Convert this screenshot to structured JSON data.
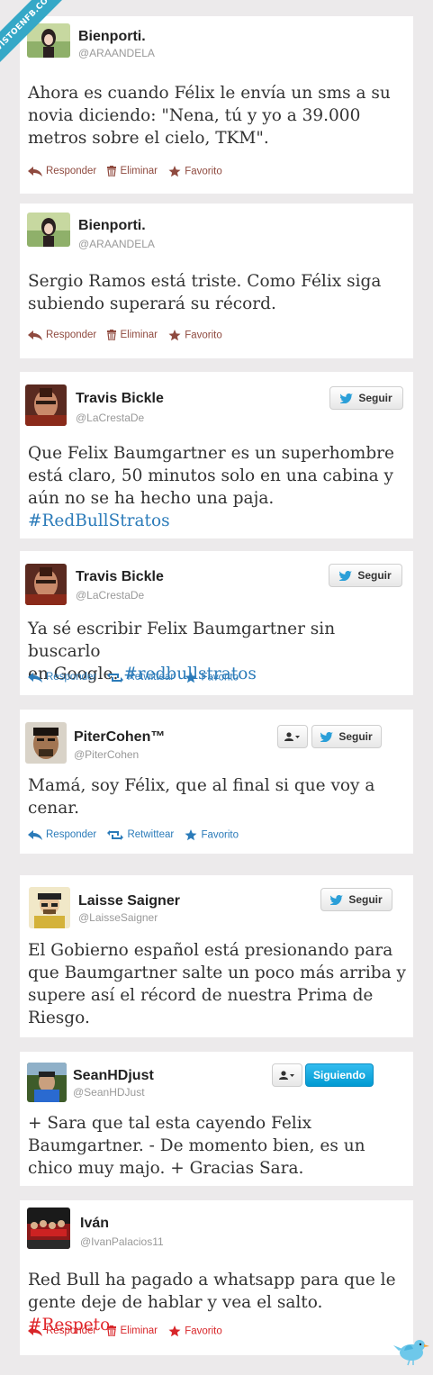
{
  "watermark": "VISTOENFB.COM",
  "tweets": [
    {
      "name": "Bienporti.",
      "handle": "@ARAANDELA",
      "text_lines": [
        "Ahora es cuando Félix le envía un sms a su",
        "novia diciendo: \"Nena, tú y yo a 39.000",
        "metros sobre el cielo, TKM\"."
      ],
      "actions": [
        "Responder",
        "Eliminar",
        "Favorito"
      ]
    },
    {
      "name": "Bienporti.",
      "handle": "@ARAANDELA",
      "text_lines": [
        "Sergio Ramos está triste. Como Félix siga",
        "subiendo superará su récord."
      ],
      "actions": [
        "Responder",
        "Eliminar",
        "Favorito"
      ]
    },
    {
      "name": "Travis Bickle",
      "handle": "@LaCrestaDe",
      "follow_label": "Seguir",
      "text_lines": [
        "Que Felix Baumgartner es un superhombre",
        "está claro, 50 minutos solo en una cabina y",
        "aún no se ha hecho una paja."
      ],
      "hashtag": "#RedBullStratos"
    },
    {
      "name": "Travis Bickle",
      "handle": "@LaCrestaDe",
      "follow_label": "Seguir",
      "text_lines": [
        "Ya sé escribir Felix Baumgartner sin buscarlo"
      ],
      "text_line2_prefix": "en Google. ",
      "hashtag": "#redbullstratos",
      "actions": [
        "Responder",
        "Retwittear",
        "Favorito"
      ]
    },
    {
      "name": "PiterCohen™",
      "handle": "@PiterCohen",
      "follow_label": "Seguir",
      "text_lines": [
        "Mamá, soy Félix, que al final si que voy a",
        "cenar."
      ],
      "actions": [
        "Responder",
        "Retwittear",
        "Favorito"
      ]
    },
    {
      "name": "Laisse Saigner",
      "handle": "@LaisseSaigner",
      "follow_label": "Seguir",
      "text_lines": [
        "El Gobierno español está presionando para",
        "que Baumgartner salte un poco más arriba y",
        "supere así el récord de nuestra Prima de",
        "Riesgo."
      ]
    },
    {
      "name": "SeanHDjust",
      "handle": "@SeanHDJust",
      "follow_label": "Siguiendo",
      "text_lines": [
        "+ Sara que tal esta cayendo Felix",
        "Baumgartner. - De momento bien, es un",
        "chico muy majo. + Gracias Sara."
      ]
    },
    {
      "name": "Iván",
      "handle": "@IvanPalacios11",
      "text_lines": [
        "Red Bull ha pagado a whatsapp para que le"
      ],
      "text_line2_prefix": "gente deje de hablar y vea el salto. ",
      "hashtag": "#Respeto",
      "actions": [
        "Responder",
        "Eliminar",
        "Favorito"
      ]
    }
  ],
  "colors": {
    "link": "#2b7bb9",
    "action_brown": "#8f4a3f",
    "hashtag_red": "#e0262a",
    "following_blue": "#019ad2",
    "background": "#eceaeb"
  }
}
